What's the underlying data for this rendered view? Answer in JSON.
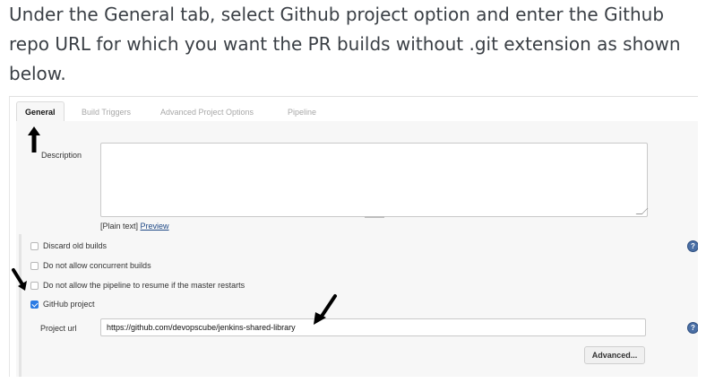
{
  "intro_text": "Under the General tab, select Github project option and enter the Github repo URL for which you want the PR builds without .git extension as shown below.",
  "tabs": [
    {
      "label": "General",
      "active": true
    },
    {
      "label": "Build Triggers",
      "active": false
    },
    {
      "label": "Advanced Project Options",
      "active": false
    },
    {
      "label": "Pipeline",
      "active": false
    }
  ],
  "description": {
    "label": "Description",
    "value": "",
    "plain_text_prefix": "[Plain text]",
    "preview_link": "Preview"
  },
  "options": {
    "discard_old_builds": {
      "label": "Discard old builds",
      "checked": false
    },
    "no_concurrent_builds": {
      "label": "Do not allow concurrent builds",
      "checked": false
    },
    "no_resume_pipeline": {
      "label": "Do not allow the pipeline to resume if the master restarts",
      "checked": false
    },
    "github_project": {
      "label": "GitHub project",
      "checked": true
    }
  },
  "project_url": {
    "label": "Project url",
    "value": "https://github.com/devopscube/jenkins-shared-library"
  },
  "advanced_button": "Advanced...",
  "help_icon_text": "?",
  "colors": {
    "checkbox_checked": "#2b7be4",
    "help_icon": "#4a6fa5",
    "link": "#204a87"
  }
}
